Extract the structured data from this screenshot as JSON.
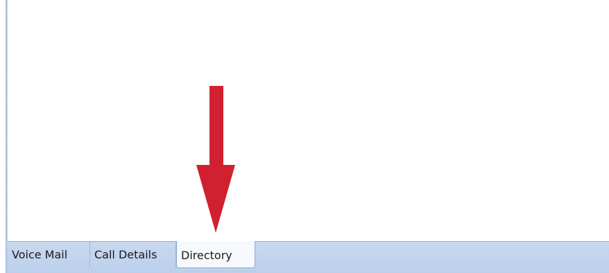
{
  "tabs": [
    {
      "label": "Voice Mail",
      "selected": false
    },
    {
      "label": "Call Details",
      "selected": false
    },
    {
      "label": "Directory",
      "selected": true
    }
  ],
  "colors": {
    "tab_strip": "#bcd0ec",
    "selected_tab": "#f6f9fd",
    "annotation_arrow": "#d1202f",
    "border": "#8ea8d3"
  },
  "annotation": {
    "icon": "down-arrow-icon",
    "points_to": "Directory"
  }
}
